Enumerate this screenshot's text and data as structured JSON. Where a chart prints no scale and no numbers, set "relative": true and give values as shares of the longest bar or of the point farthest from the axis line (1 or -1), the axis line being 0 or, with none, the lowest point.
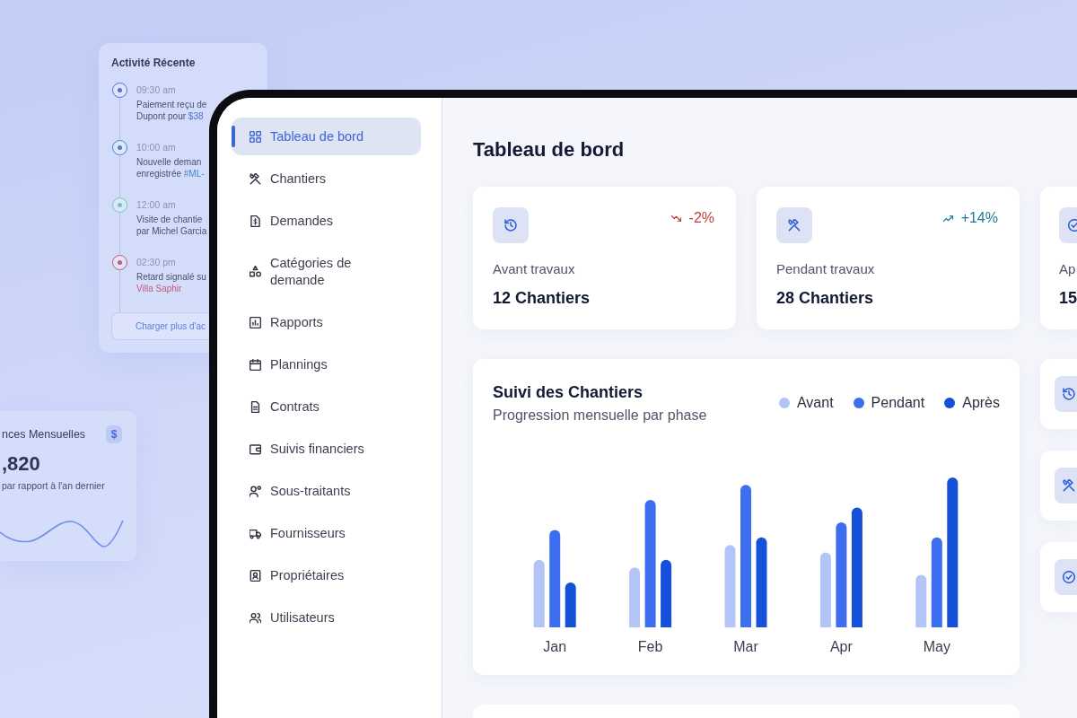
{
  "activity": {
    "title": "Activité Récente",
    "items": [
      {
        "time": "09:30 am",
        "text": "Paiement reçu de Dupont pour",
        "highlight": "$38",
        "color": "#4a72d9"
      },
      {
        "time": "10:00 am",
        "text": "Nouvelle deman enregistrée",
        "highlight": "#ML-",
        "color": "#3f86cf"
      },
      {
        "time": "12:00 am",
        "text": "Visite de chantie par Michel Garcia",
        "color": "#6cc9b4"
      },
      {
        "time": "02:30 pm",
        "text": "Retard signalé su",
        "highlight": "Villa Saphir",
        "color": "#c45a78"
      }
    ],
    "button": "Charger plus d'ac"
  },
  "revenue": {
    "title": "nces Mensuelles",
    "badge": "$",
    "value": ",820",
    "caption": "par rapport à l'an dernier"
  },
  "sidebar": {
    "items": [
      {
        "label": "Tableau de bord",
        "selected": true
      },
      {
        "label": "Chantiers",
        "selected": false
      },
      {
        "label": "Demandes",
        "selected": false
      },
      {
        "label": "Catégories de demande",
        "selected": false
      },
      {
        "label": "Rapports",
        "selected": false
      },
      {
        "label": "Plannings",
        "selected": false
      },
      {
        "label": "Contrats",
        "selected": false
      },
      {
        "label": "Suivis financiers",
        "selected": false
      },
      {
        "label": "Sous-traitants",
        "selected": false
      },
      {
        "label": "Fournisseurs",
        "selected": false
      },
      {
        "label": "Propriétaires",
        "selected": false
      },
      {
        "label": "Utilisateurs",
        "selected": false
      }
    ]
  },
  "page_title": "Tableau de bord",
  "stats": [
    {
      "label": "Avant travaux",
      "value": "12 Chantiers",
      "trend": "-2%",
      "falling": true
    },
    {
      "label": "Pendant travaux",
      "value": "28 Chantiers",
      "trend": "+14%",
      "falling": false
    },
    {
      "label": "Ap",
      "value": "15"
    }
  ],
  "chart_card": {
    "title": "Suivi des Chantiers",
    "subtitle": "Progression mensuelle par phase",
    "chart_data": {
      "type": "bar",
      "relative": true,
      "categories": [
        "Jan",
        "Feb",
        "Mar",
        "Apr",
        "May"
      ],
      "series": [
        {
          "name": "Avant",
          "color": "#b3c5f7",
          "values": [
            0.45,
            0.4,
            0.55,
            0.5,
            0.35
          ]
        },
        {
          "name": "Pendant",
          "color": "#3d6ef0",
          "values": [
            0.65,
            0.85,
            0.95,
            0.7,
            0.6
          ]
        },
        {
          "name": "Après",
          "color": "#1550d8",
          "values": [
            0.3,
            0.45,
            0.6,
            0.8,
            1
          ]
        }
      ]
    }
  }
}
